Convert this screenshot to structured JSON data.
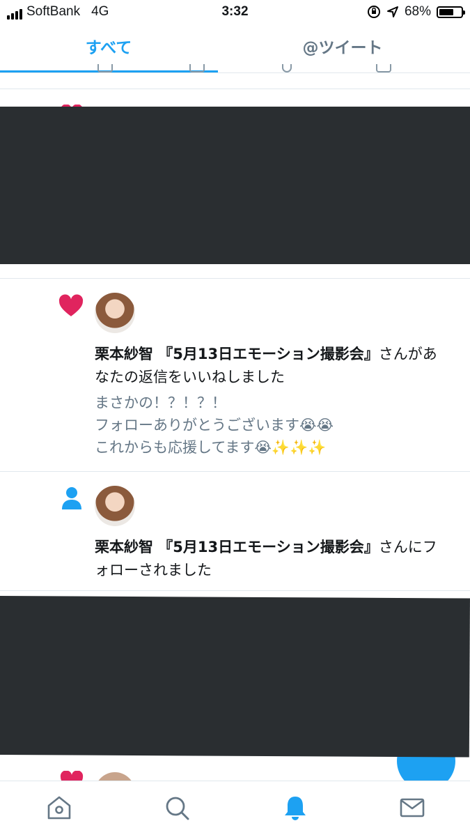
{
  "status_bar": {
    "carrier": "SoftBank",
    "network": "4G",
    "time": "3:32",
    "battery_percent": "68%",
    "battery_level": 0.68
  },
  "tabs": [
    {
      "label": "すべて",
      "active": true
    },
    {
      "label": "@ツイート",
      "active": false
    }
  ],
  "notifications": [
    {
      "type_icon": "heart-icon",
      "user_name": "栗本紗智 『5月13日エモーション撮影会』",
      "action": "さんがあなたの返信をいいねしました",
      "quoted_text": "まさかの！？！？！\nフォローありがとうございます😭😭\nこれからも応援してます😭✨✨✨"
    },
    {
      "type_icon": "person-icon",
      "user_name": "栗本紗智 『5月13日エモーション撮影会』",
      "action": "さんにフォローされました"
    }
  ],
  "bottom_nav": [
    {
      "icon": "home-icon"
    },
    {
      "icon": "search-icon"
    },
    {
      "icon": "notifications-bell-icon",
      "active": true
    },
    {
      "icon": "messages-icon"
    }
  ],
  "colors": {
    "accent": "#1da1f2",
    "like": "#e0245e",
    "muted": "#657786",
    "redaction": "#2a2e31"
  }
}
